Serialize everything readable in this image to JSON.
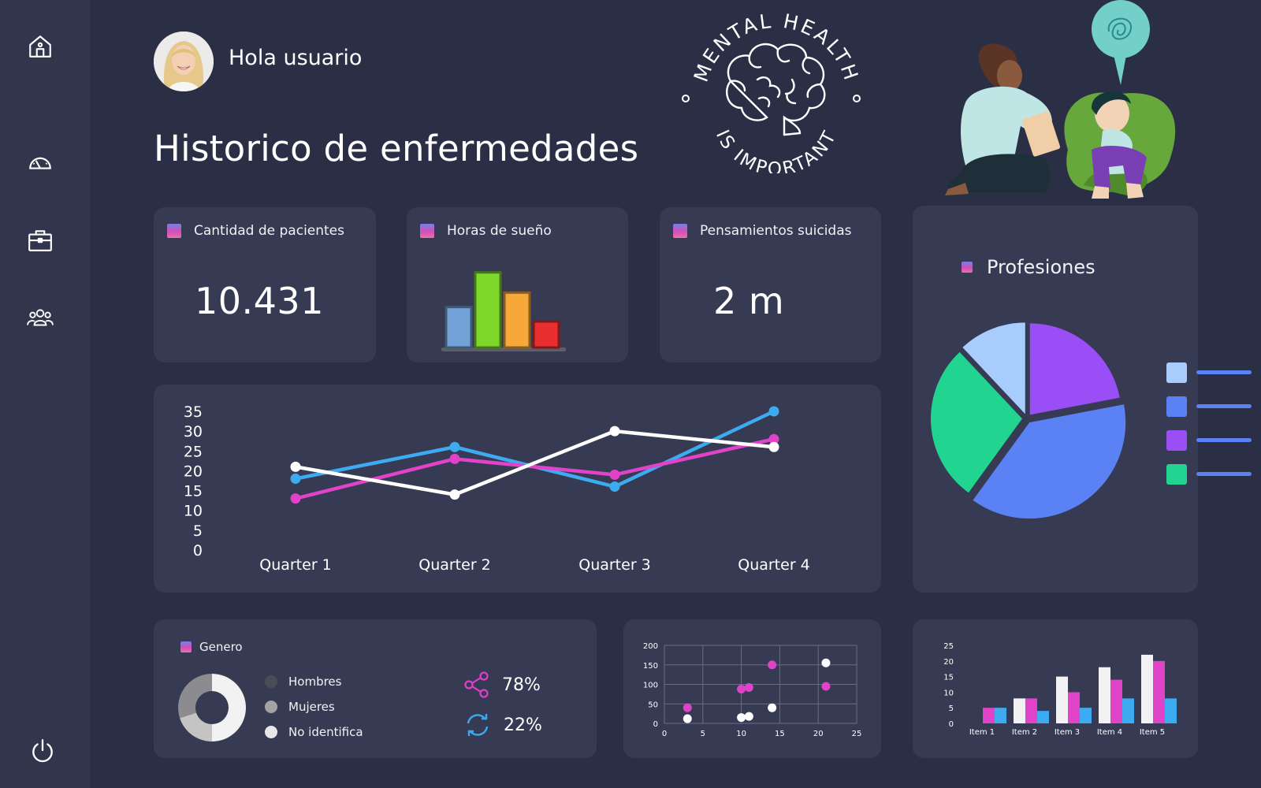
{
  "header": {
    "greeting": "Hola usuario",
    "title": "Historico de enfermedades"
  },
  "badge": {
    "top_text": "MENTAL HEALTH",
    "bottom_text": "IS IMPORTANT"
  },
  "sidebar": {
    "items": [
      {
        "name": "home",
        "icon": "home-icon"
      },
      {
        "name": "dashboard",
        "icon": "speedometer-icon"
      },
      {
        "name": "briefcase",
        "icon": "briefcase-icon"
      },
      {
        "name": "users",
        "icon": "users-icon"
      },
      {
        "name": "power",
        "icon": "power-icon"
      }
    ]
  },
  "stats": {
    "patients": {
      "label": "Cantidad de pacientes",
      "value": "10.431"
    },
    "sleep": {
      "label": "Horas de sueño"
    },
    "suicidal": {
      "label": "Pensamientos suicidas",
      "value": "2 m"
    }
  },
  "profesiones": {
    "label": "Profesiones",
    "colors": [
      "#a8cdfd",
      "#5a82f5",
      "#9a4ef5",
      "#21d48f"
    ]
  },
  "genero": {
    "label": "Genero",
    "legend": [
      {
        "label": "Hombres",
        "color": "#4a4c57"
      },
      {
        "label": "Mujeres",
        "color": "#a3a3a6"
      },
      {
        "label": "No identifica",
        "color": "#e6e6e8"
      }
    ],
    "stats": [
      {
        "icon": "share-icon",
        "value": "78%",
        "color": "#e040c8"
      },
      {
        "icon": "refresh-icon",
        "value": "22%",
        "color": "#3aaaf0"
      }
    ]
  },
  "chart_data": [
    {
      "type": "bar",
      "categories": [
        "",
        "",
        "",
        ""
      ],
      "values": [
        14,
        26,
        19,
        9
      ],
      "colors": [
        "#72a2d8",
        "#7ed82c",
        "#f8a838",
        "#e82e2e"
      ],
      "ylim": [
        0,
        30
      ]
    },
    {
      "type": "line",
      "categories": [
        "Quarter 1",
        "Quarter 2",
        "Quarter 3",
        "Quarter 4"
      ],
      "yticks": [
        0,
        5,
        10,
        15,
        20,
        25,
        30,
        35
      ],
      "ylim": [
        0,
        35
      ],
      "series": [
        {
          "color": "#3eaaf0",
          "values": [
            18,
            26,
            16,
            35
          ]
        },
        {
          "color": "#e043c8",
          "values": [
            13,
            23,
            19,
            28
          ]
        },
        {
          "color": "#ffffff",
          "values": [
            21,
            14,
            30,
            26
          ]
        }
      ]
    },
    {
      "type": "pie",
      "values": [
        12,
        22,
        38,
        28
      ],
      "colors": [
        "#a8cdfd",
        "#9a4ef5",
        "#5a82f5",
        "#21d48f"
      ]
    },
    {
      "type": "pie",
      "values": [
        50,
        20,
        30
      ],
      "colors": [
        "#f2f2f2",
        "#c4c4c4",
        "#8c8c90"
      ]
    },
    {
      "type": "scatter",
      "xlim": [
        0,
        25
      ],
      "ylim": [
        0,
        200
      ],
      "xticks": [
        0,
        5,
        10,
        15,
        20,
        25
      ],
      "yticks": [
        0,
        50,
        100,
        150,
        200
      ],
      "series": [
        {
          "color": "#e043c8",
          "points": [
            [
              3,
              40
            ],
            [
              10,
              88
            ],
            [
              11,
              92
            ],
            [
              14,
              150
            ],
            [
              21,
              95
            ]
          ]
        },
        {
          "color": "#ffffff",
          "points": [
            [
              3,
              12
            ],
            [
              10,
              15
            ],
            [
              11,
              18
            ],
            [
              14,
              40
            ],
            [
              21,
              155
            ]
          ]
        }
      ]
    },
    {
      "type": "bar",
      "categories": [
        "Item 1",
        "Item 2",
        "Item 3",
        "Item 4",
        "Item 5"
      ],
      "ylim": [
        0,
        25
      ],
      "yticks": [
        0,
        5,
        10,
        15,
        20,
        25
      ],
      "series": [
        {
          "color": "#f2f2f5",
          "values": [
            0,
            8,
            15,
            18,
            22
          ]
        },
        {
          "color": "#e043c8",
          "values": [
            5,
            8,
            10,
            14,
            20
          ]
        },
        {
          "color": "#3eaaf0",
          "values": [
            5,
            4,
            5,
            8,
            8
          ]
        }
      ]
    }
  ]
}
